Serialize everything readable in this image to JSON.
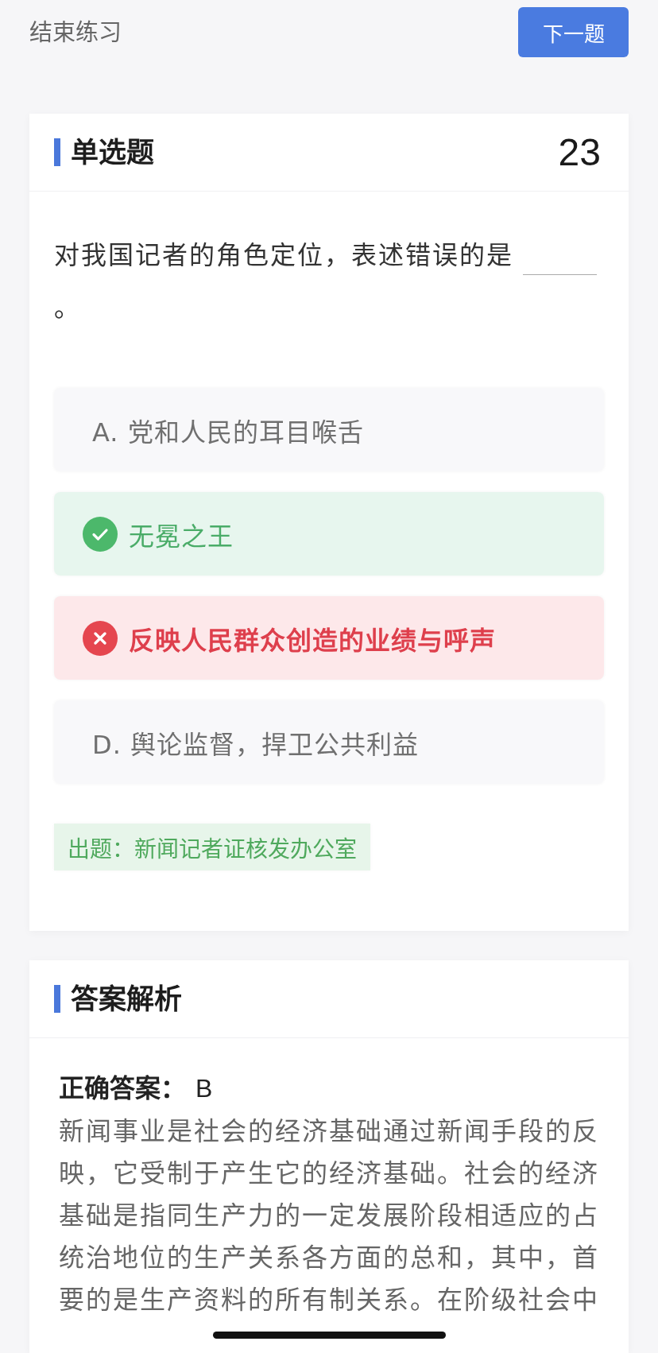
{
  "top_bar": {
    "end_link": "结束练习",
    "next_button": "下一题"
  },
  "question_card": {
    "title": "单选题",
    "number": "23",
    "question": {
      "text": "对我国记者的角色定位，表述错误的是",
      "end": "。"
    },
    "options": [
      {
        "label": "A. 党和人民的耳目喉舌",
        "kind": "plain"
      },
      {
        "label": "无冕之王",
        "kind": "correct"
      },
      {
        "label": "反映人民群众创造的业绩与呼声",
        "kind": "wrong"
      },
      {
        "label": "D. 舆论监督，捍卫公共利益",
        "kind": "plain"
      }
    ],
    "source": "出题：新闻记者证核发办公室"
  },
  "analysis_card": {
    "title": "答案解析",
    "answer_label": "正确答案：",
    "answer": "B",
    "explanation": "新闻事业是社会的经济基础通过新闻手段的反映，它受制于产生它的经济基础。社会的经济基础是指同生产力的一定发展阶段相适应的占统治地位的生产关系各方面的总和，其中，首要的是生产资料的所有制关系。在阶级社会中"
  }
}
